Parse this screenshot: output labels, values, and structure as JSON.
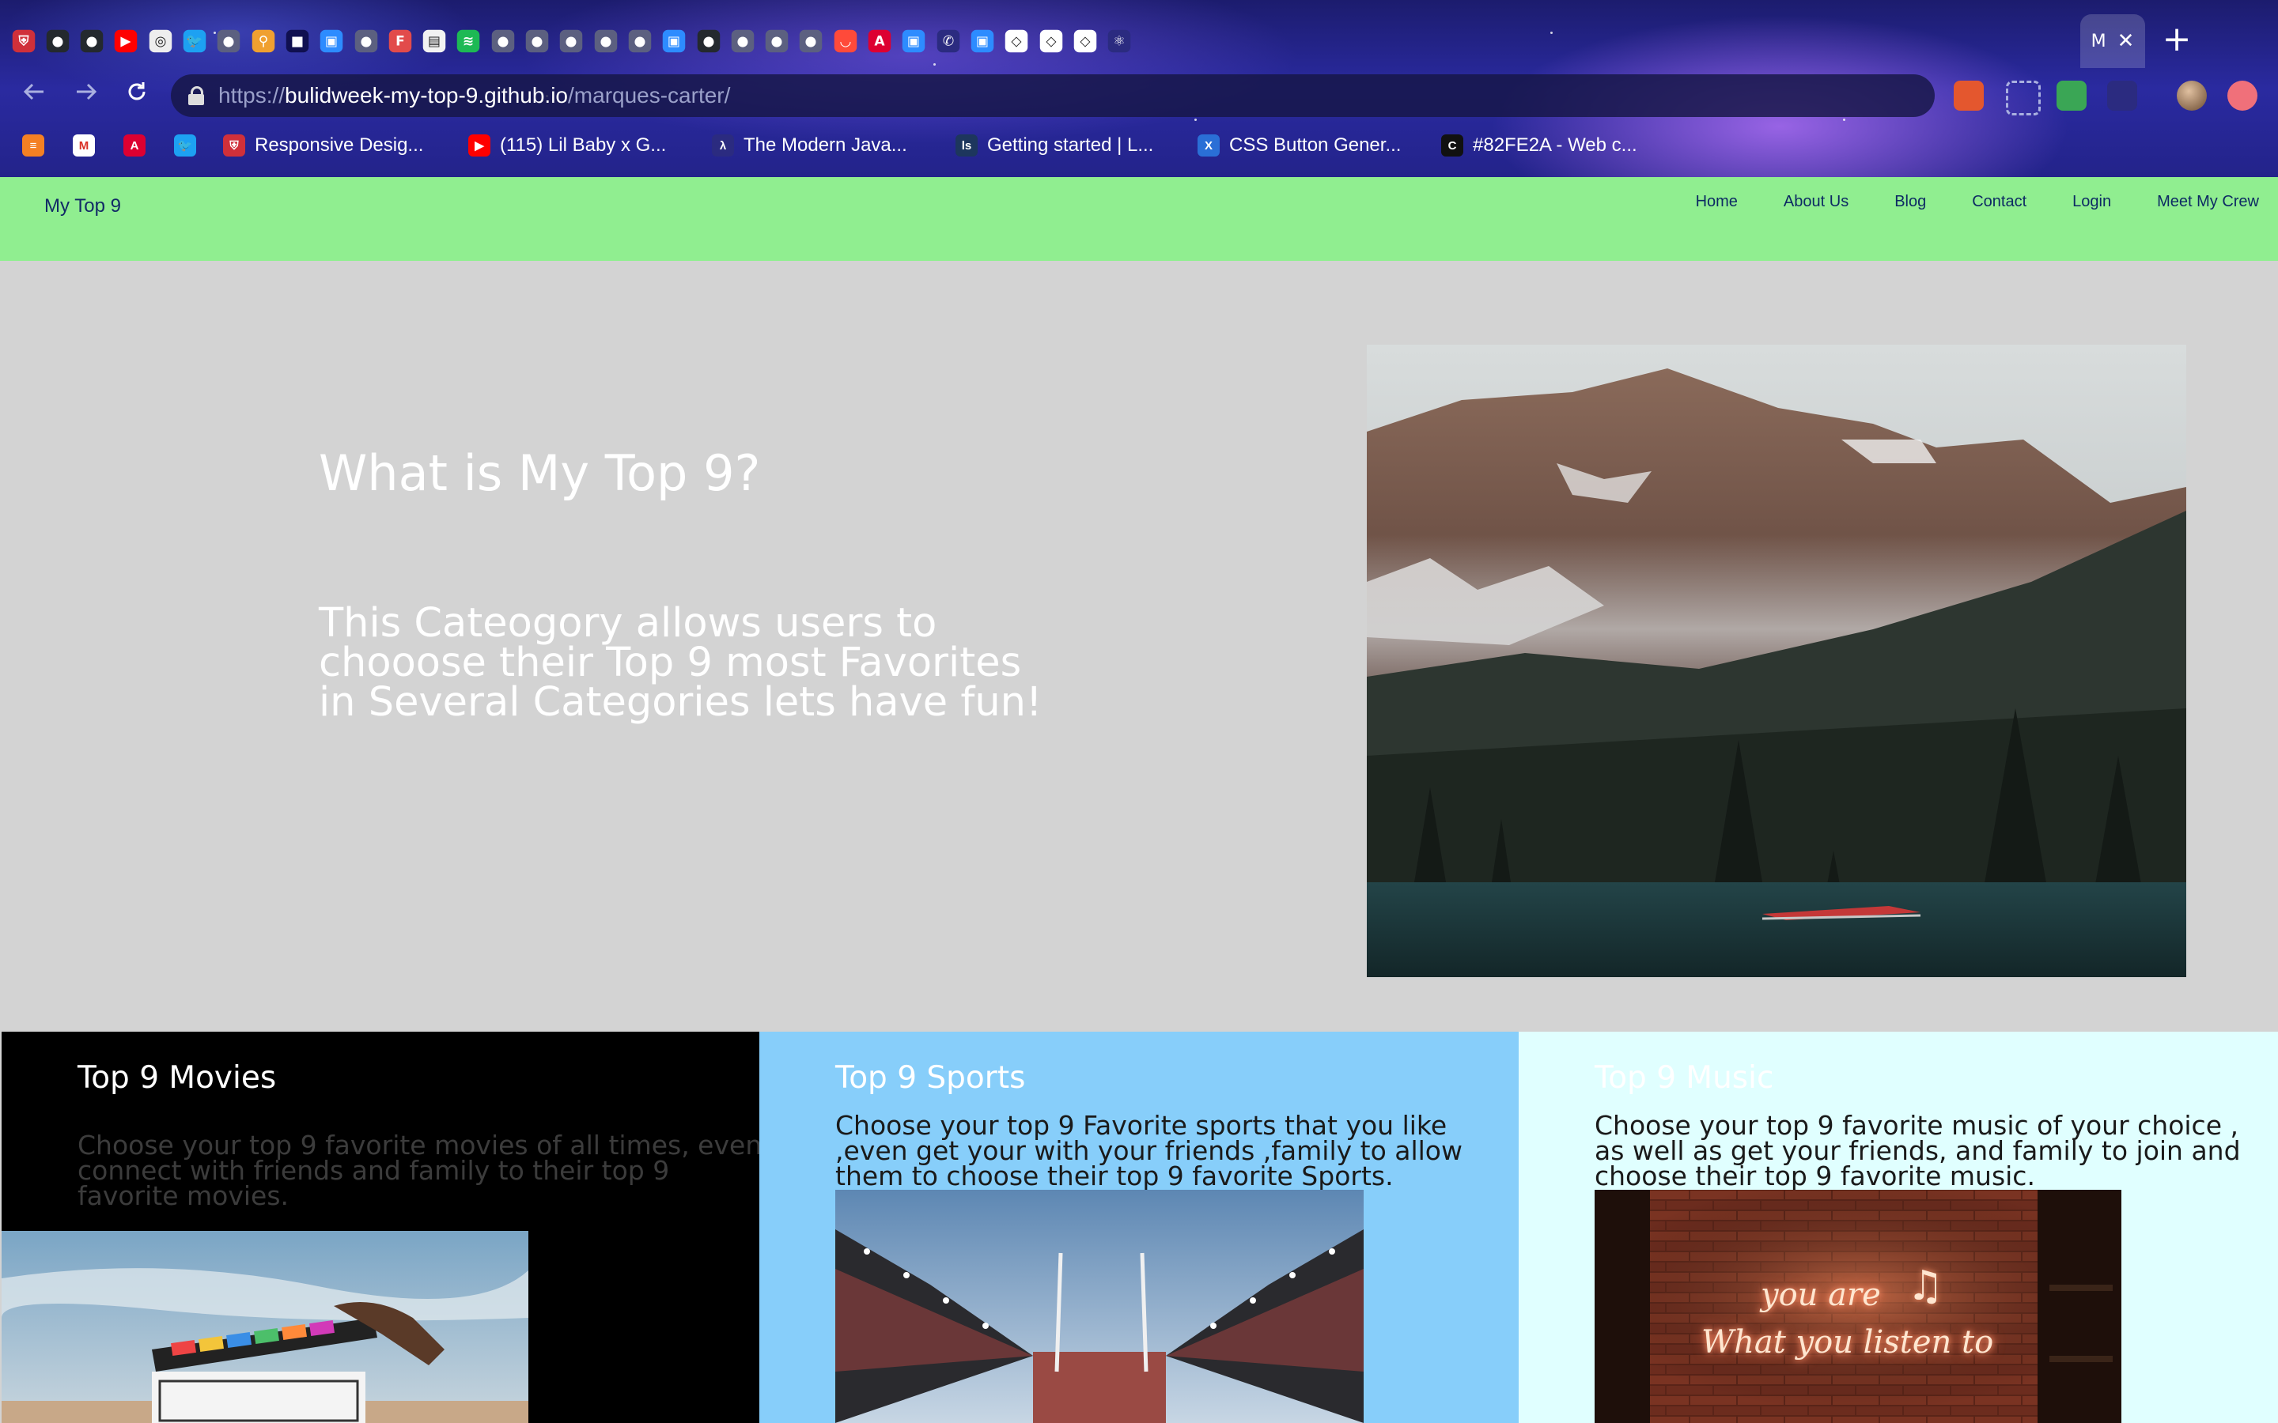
{
  "browser": {
    "tabs": [
      {
        "icon": "shield-red-icon"
      },
      {
        "icon": "github-icon"
      },
      {
        "icon": "github-icon"
      },
      {
        "icon": "youtube-icon"
      },
      {
        "icon": "spiral-icon"
      },
      {
        "icon": "twitter-icon"
      },
      {
        "icon": "globe-icon"
      },
      {
        "icon": "accessibility-icon"
      },
      {
        "icon": "pixel-icon"
      },
      {
        "icon": "zoom-icon"
      },
      {
        "icon": "globe-icon"
      },
      {
        "icon": "f-icon"
      },
      {
        "icon": "doc-icon"
      },
      {
        "icon": "spotify-icon"
      },
      {
        "icon": "globe-icon"
      },
      {
        "icon": "globe-icon"
      },
      {
        "icon": "globe-icon"
      },
      {
        "icon": "globe-icon"
      },
      {
        "icon": "globe-icon"
      },
      {
        "icon": "zoom-icon"
      },
      {
        "icon": "github-icon"
      },
      {
        "icon": "globe-icon"
      },
      {
        "icon": "globe-icon"
      },
      {
        "icon": "globe-icon"
      },
      {
        "icon": "bag-icon"
      },
      {
        "icon": "angular-icon"
      },
      {
        "icon": "zoom-icon"
      },
      {
        "icon": "phone-icon"
      },
      {
        "icon": "zoom-icon"
      },
      {
        "icon": "codepen-icon"
      },
      {
        "icon": "codepen-icon"
      },
      {
        "icon": "codepen-icon"
      },
      {
        "icon": "react-icon"
      }
    ],
    "active_tab": {
      "title": "M",
      "close_label": "✕"
    },
    "new_tab_label": "+",
    "url": {
      "scheme": "https://",
      "host": "bulidweek-my-top-9.github.io",
      "path": "/marques-carter/"
    },
    "bookmarks": [
      {
        "label": "",
        "icon": "stackoverflow-icon"
      },
      {
        "label": "",
        "icon": "gmail-icon"
      },
      {
        "label": "",
        "icon": "angular-icon"
      },
      {
        "label": "",
        "icon": "twitter-icon"
      },
      {
        "label": "Responsive Desig...",
        "icon": "shield-red-icon"
      },
      {
        "label": "(115) Lil Baby x G...",
        "icon": "youtube-icon"
      },
      {
        "label": "The Modern Java...",
        "icon": "figure-icon"
      },
      {
        "label": "Getting started | L...",
        "icon": "less-icon"
      },
      {
        "label": "CSS Button Gener...",
        "icon": "x-icon"
      },
      {
        "label": "#82FE2A - Web c...",
        "icon": "c-icon"
      }
    ]
  },
  "site": {
    "brand": "My Top 9",
    "nav": [
      "Home",
      "About Us",
      "Blog",
      "Contact",
      "Login",
      "Meet My Crew"
    ],
    "hero": {
      "title": "What is My Top 9?",
      "text": "This Cateogory allows users to chooose their Top 9 most Favorites in Several Categories lets have fun!"
    },
    "cards": {
      "movies": {
        "title": "Top 9 Movies",
        "text": "Choose your top 9 favorite movies of all times, even connect with friends and family to their top 9 favorite movies."
      },
      "sports": {
        "title": "Top 9 Sports",
        "text": "Choose your top 9 Favorite sports that you like ,even get your with your friends ,family to allow them to choose their top 9 favorite Sports."
      },
      "music": {
        "title": "Top 9 Music",
        "text": "Choose your top 9 favorite music of your choice , as well as get your friends, and family to join and choose their top 9 favorite music.",
        "neon_line1": "you are",
        "neon_line2": "What you listen to"
      }
    },
    "colors": {
      "nav_bg": "#90ee90",
      "hero_bg": "#d3d3d3",
      "movies_bg": "#000000",
      "sports_bg": "#87cefa",
      "music_bg": "#e0ffff"
    }
  }
}
